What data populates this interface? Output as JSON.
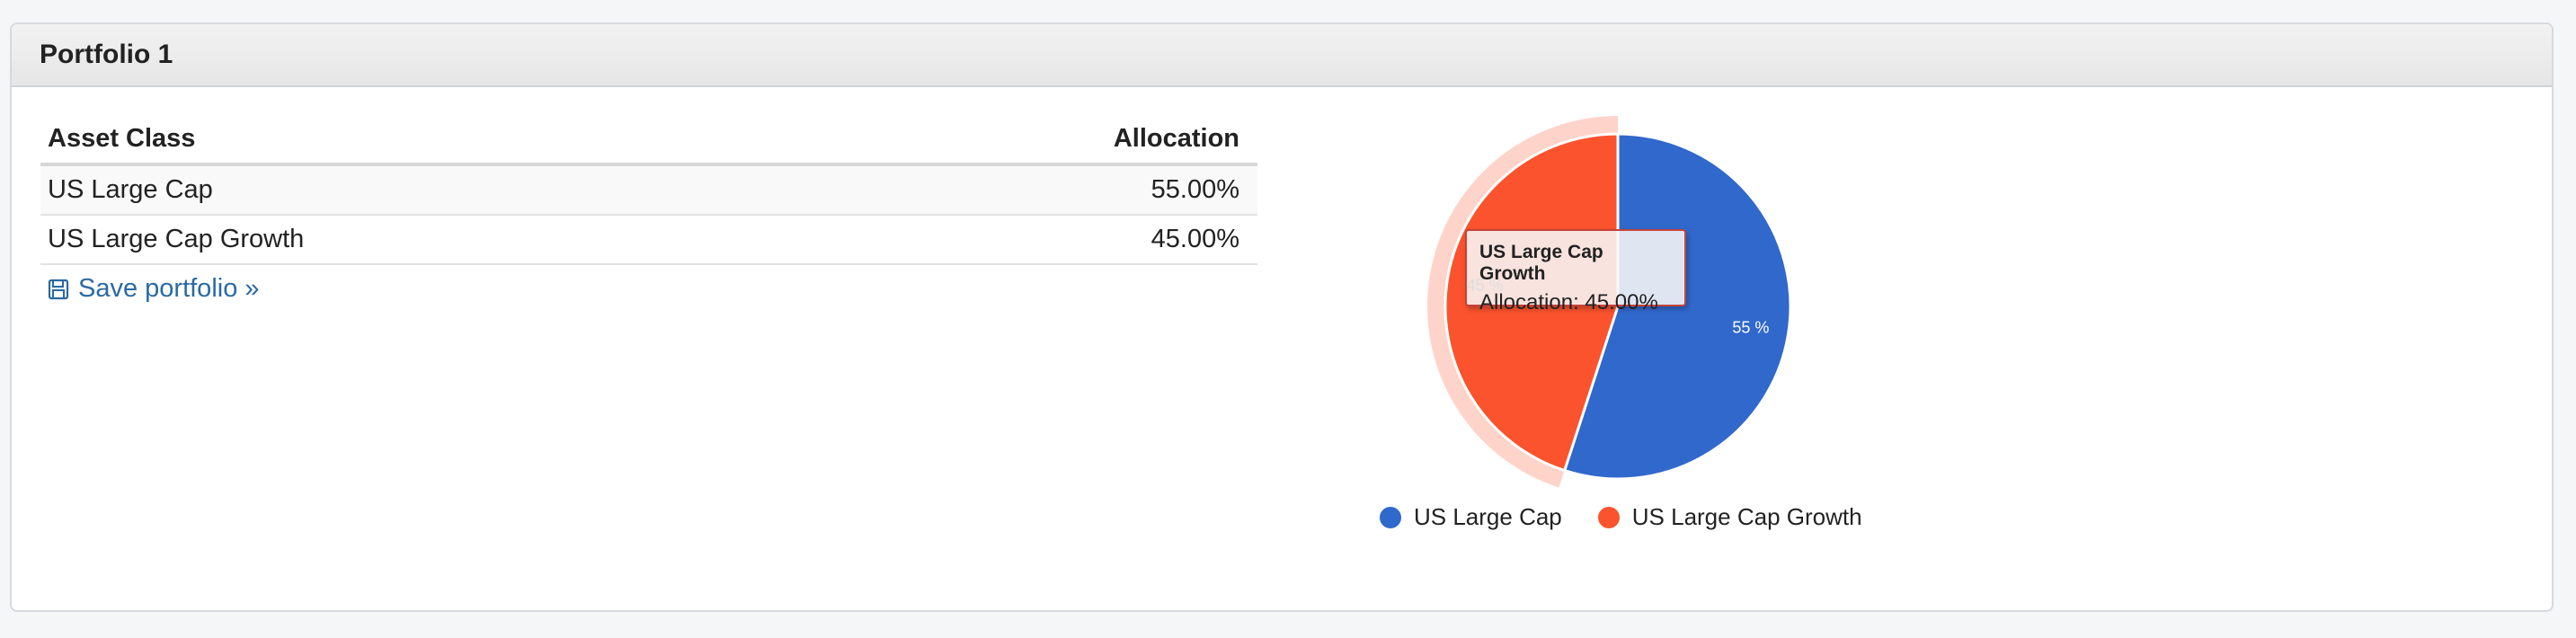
{
  "panel": {
    "title": "Portfolio 1"
  },
  "table": {
    "headers": {
      "asset_class": "Asset Class",
      "allocation": "Allocation"
    },
    "rows": [
      {
        "asset_class": "US Large Cap",
        "allocation": "55.00%"
      },
      {
        "asset_class": "US Large Cap Growth",
        "allocation": "45.00%"
      }
    ]
  },
  "actions": {
    "save_label": "Save portfolio »",
    "save_icon": "floppy-disk-icon"
  },
  "tooltip": {
    "title": "US Large Cap Growth",
    "body": "Allocation: 45.00%"
  },
  "chart_data": {
    "type": "pie",
    "slices": [
      {
        "name": "US Large Cap",
        "value": 55,
        "label": "55 %",
        "color": "#3068cc"
      },
      {
        "name": "US Large Cap Growth",
        "value": 45,
        "label": "45 %",
        "color": "#fa532d",
        "hovered": true
      }
    ],
    "legend_position": "bottom"
  }
}
